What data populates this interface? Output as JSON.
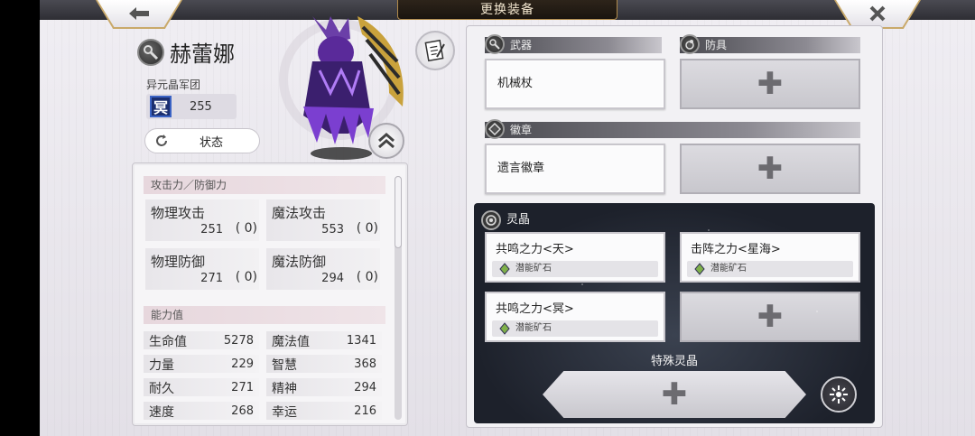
{
  "header": {
    "title": "更换装备",
    "back_icon": "arrow-left-icon",
    "close_icon": "close-x-icon"
  },
  "character": {
    "name": "赫蕾娜",
    "faction": "异元晶军团",
    "level_glyph": "冥",
    "level": "255",
    "status_button": "状态"
  },
  "stats": {
    "atk_def_title": "攻击力／防御力",
    "cells": [
      {
        "name": "物理攻击",
        "value": "251",
        "bonus": "(      0)"
      },
      {
        "name": "魔法攻击",
        "value": "553",
        "bonus": "(      0)"
      },
      {
        "name": "物理防御",
        "value": "271",
        "bonus": "(      0)"
      },
      {
        "name": "魔法防御",
        "value": "294",
        "bonus": "(      0)"
      }
    ],
    "ability_title": "能力值",
    "abilities": [
      {
        "name": "生命值",
        "value": "5278"
      },
      {
        "name": "魔法值",
        "value": "1341"
      },
      {
        "name": "力量",
        "value": "229"
      },
      {
        "name": "智慧",
        "value": "368"
      },
      {
        "name": "耐久",
        "value": "271"
      },
      {
        "name": "精神",
        "value": "294"
      },
      {
        "name": "速度",
        "value": "268"
      },
      {
        "name": "幸运",
        "value": "216"
      }
    ]
  },
  "equipment": {
    "weapon_label": "武器",
    "weapon_item": "机械杖",
    "armor_label": "防具",
    "badge_label": "徽章",
    "badge_item": "遗言徽章",
    "crystal_label": "灵晶",
    "crystals": [
      {
        "name": "共鸣之力<天>",
        "sub": "潜能矿石"
      },
      {
        "name": "击阵之力<星海>",
        "sub": "潜能矿石"
      },
      {
        "name": "共鸣之力<冥>",
        "sub": "潜能矿石"
      }
    ],
    "special_label": "特殊灵晶"
  },
  "colors": {
    "accent_gold": "#c9a96a",
    "dark_panel": "#1d212b",
    "level_blue": "#1c2f6f"
  }
}
